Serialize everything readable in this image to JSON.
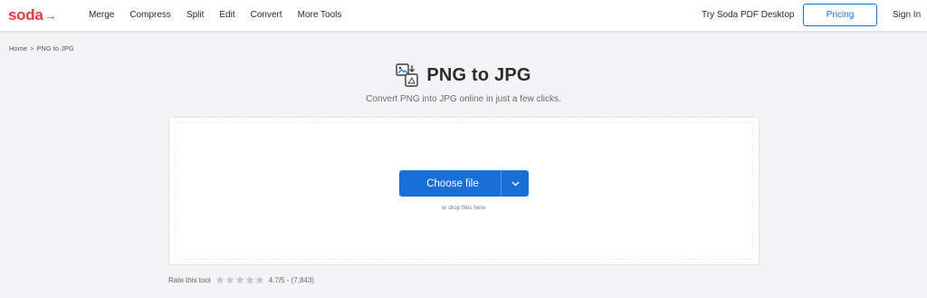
{
  "brand": {
    "logo_text": "soda",
    "logo_arrow": "→",
    "color": "#e63946"
  },
  "nav": {
    "items": [
      "Merge",
      "Compress",
      "Split",
      "Edit",
      "Convert",
      "More Tools"
    ],
    "desktop_link": "Try Soda PDF Desktop",
    "pricing_label": "Pricing",
    "signin_label": "Sign In",
    "accent_color": "#1a6fd6"
  },
  "breadcrumb": {
    "home": "Home",
    "separator": ">",
    "current": "PNG to JPG"
  },
  "hero": {
    "icon": "png-to-jpg-icon",
    "title": "PNG to JPG",
    "subtitle": "Convert PNG into JPG online in just a few clicks."
  },
  "upload": {
    "button_label": "Choose file",
    "dropdown_icon": "chevron-down-icon",
    "drop_hint": "or drop files here"
  },
  "rating": {
    "label": "Rate this tool",
    "score": "4.7/5 - (7,843)",
    "stars_total": 5,
    "star_color": "#c8c8cc"
  }
}
